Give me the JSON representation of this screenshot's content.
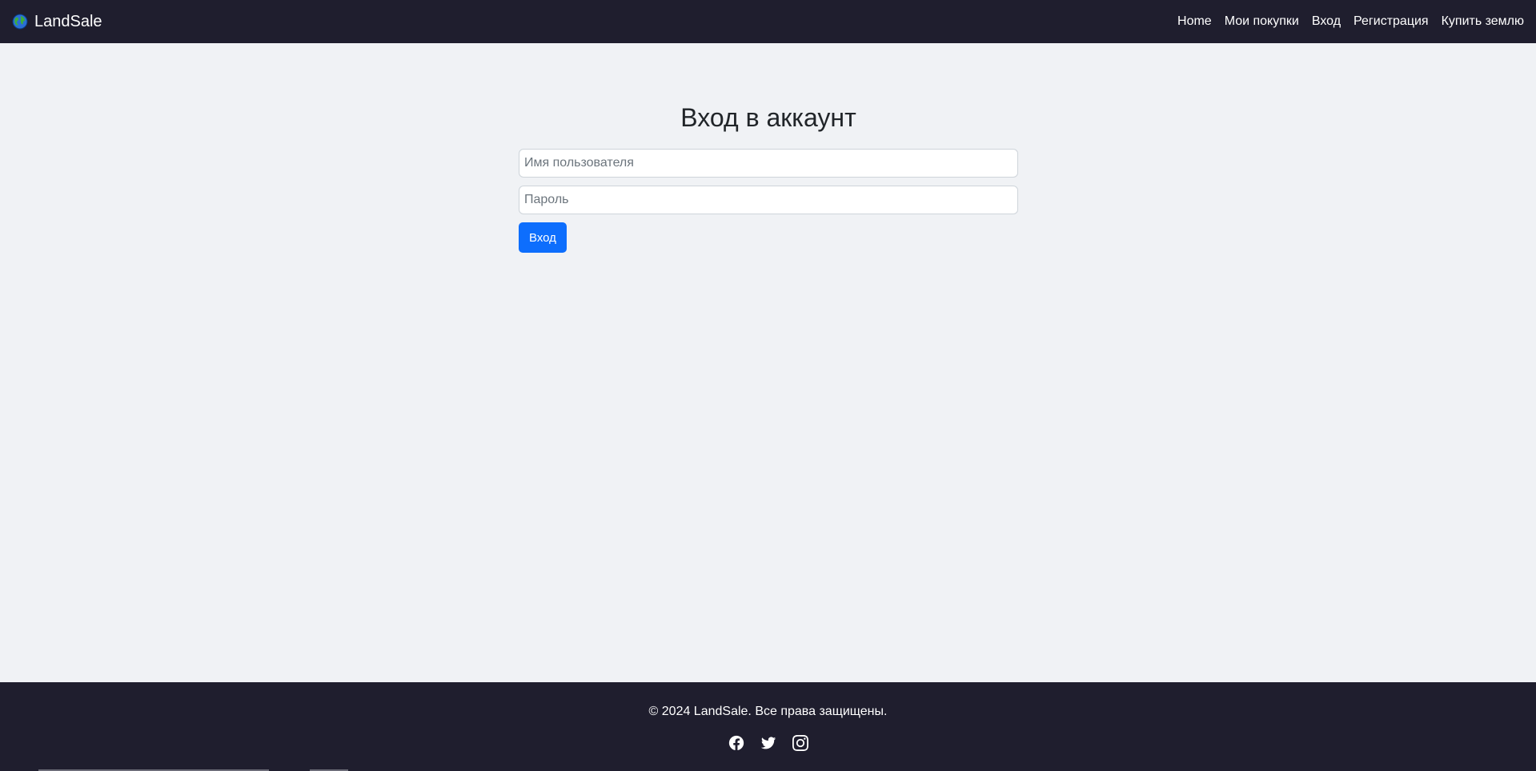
{
  "navbar": {
    "brand": "LandSale",
    "brand_icon": "globe-icon",
    "links": [
      "Home",
      "Мои покупки",
      "Вход",
      "Регистрация",
      "Купить землю"
    ]
  },
  "login": {
    "title": "Вход в аккаунт",
    "username_placeholder": "Имя пользователя",
    "username_value": "",
    "password_placeholder": "Пароль",
    "password_value": "",
    "submit_label": "Вход"
  },
  "footer": {
    "copyright": "© 2024 LandSale. Все права защищены.",
    "social": [
      "facebook-icon",
      "twitter-icon",
      "instagram-icon"
    ]
  },
  "colors": {
    "navbar_bg": "#1f1e2e",
    "page_bg": "#f0f2f5",
    "primary": "#0d6efd"
  }
}
